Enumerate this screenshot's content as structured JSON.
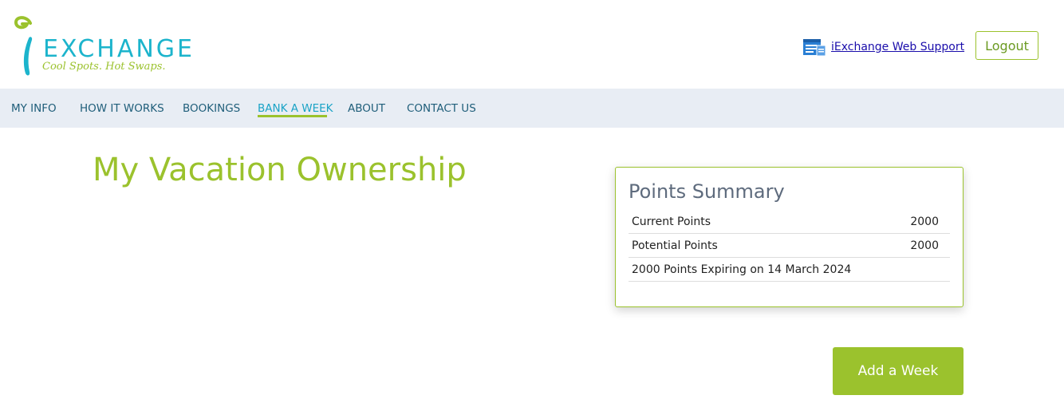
{
  "brand": {
    "logo_word": "EXCHANGE",
    "tagline": "Cool Spots. Hot Swaps.",
    "green": "#9bc22d",
    "teal": "#1cb4cc"
  },
  "header": {
    "support_icon": "support-document-icon",
    "support_link": "iExchange Web Support",
    "logout_label": "Logout"
  },
  "nav": {
    "items": [
      {
        "label": "MY INFO"
      },
      {
        "label": "HOW IT WORKS"
      },
      {
        "label": "BOOKINGS"
      },
      {
        "label": "BANK A WEEK",
        "active": true
      },
      {
        "label": "ABOUT"
      },
      {
        "label": "CONTACT US"
      }
    ]
  },
  "main": {
    "title": "My Vacation Ownership",
    "points_summary": {
      "title": "Points Summary",
      "rows": [
        {
          "label": "Current Points",
          "value": "2000"
        },
        {
          "label": "Potential Points",
          "value": "2000"
        },
        {
          "label": "2000 Points Expiring on 14 March 2024",
          "value": ""
        }
      ]
    },
    "add_week_label": "Add a Week"
  }
}
